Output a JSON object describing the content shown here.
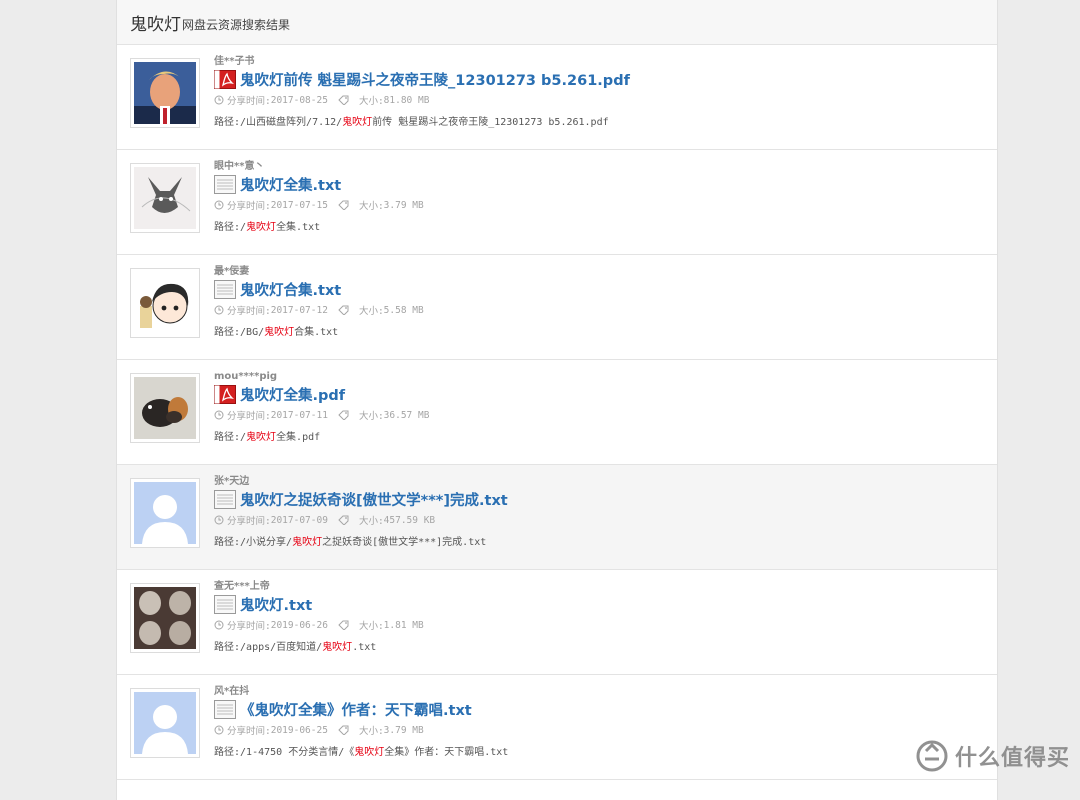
{
  "header": {
    "keyword": "鬼吹灯",
    "subtitle": "网盘云资源搜索结果"
  },
  "labels": {
    "share_time": "分享时间:",
    "size": "大小:",
    "path": "路径:"
  },
  "results": [
    {
      "user": "佳**子书",
      "type": "pdf",
      "title_kw": "鬼吹灯",
      "title_rest": "前传 魁星踢斗之夜帝王陵_12301273 b5.261.pdf",
      "date": "2017-08-25",
      "size": "81.80 MB",
      "path_pre": "/山西磁盘阵列/7.12/",
      "path_kw": "鬼吹灯",
      "path_post": "前传 魁星踢斗之夜帝王陵_12301273 b5.261.pdf",
      "avatar": "photo-man"
    },
    {
      "user": "眼中**意丶",
      "type": "txt",
      "title_kw": "鬼吹灯",
      "title_rest": "全集.txt",
      "date": "2017-07-15",
      "size": "3.79 MB",
      "path_pre": "/",
      "path_kw": "鬼吹灯",
      "path_post": "全集.txt",
      "avatar": "sketch-cat"
    },
    {
      "user": "最*佞妻",
      "type": "txt",
      "title_kw": "鬼吹灯",
      "title_rest": "合集.txt",
      "date": "2017-07-12",
      "size": "5.58 MB",
      "path_pre": "/BG/",
      "path_kw": "鬼吹灯",
      "path_post": "合集.txt",
      "avatar": "anime"
    },
    {
      "user": "mou****pig",
      "type": "pdf",
      "title_kw": "鬼吹灯",
      "title_rest": "全集.pdf",
      "date": "2017-07-11",
      "size": "36.57 MB",
      "path_pre": "/",
      "path_kw": "鬼吹灯",
      "path_post": "全集.pdf",
      "avatar": "photo-pet"
    },
    {
      "user": "张*天边",
      "type": "txt",
      "title_kw": "鬼吹灯",
      "title_rest": "之捉妖奇谈[傲世文学***]完成.txt",
      "date": "2017-07-09",
      "size": "457.59 KB",
      "path_pre": "/小说分享/",
      "path_kw": "鬼吹灯",
      "path_post": "之捉妖奇谈[傲世文学***]完成.txt",
      "avatar": "default"
    },
    {
      "user": "查无***上帝",
      "type": "txt",
      "title_kw": "鬼吹灯",
      "title_rest": ".txt",
      "date": "2019-06-26",
      "size": "1.81 MB",
      "path_pre": "/apps/百度知道/",
      "path_kw": "鬼吹灯",
      "path_post": ".txt",
      "avatar": "photo-grid"
    },
    {
      "user": "风*在抖",
      "type": "txt",
      "title_pre": "《",
      "title_kw": "鬼吹灯",
      "title_rest": "全集》作者：天下霸唱.txt",
      "date": "2019-06-25",
      "size": "3.79 MB",
      "path_pre": "/1-4750 不分类言情/《",
      "path_kw": "鬼吹灯",
      "path_post": "全集》作者：天下霸唱.txt",
      "avatar": "default"
    }
  ],
  "watermark": {
    "text": "什么值得买",
    "icon": "smzdm-logo"
  },
  "colors": {
    "link": "#2a6fb2",
    "keyword_highlight": "#e60012",
    "pdf_icon": "#d42020"
  }
}
